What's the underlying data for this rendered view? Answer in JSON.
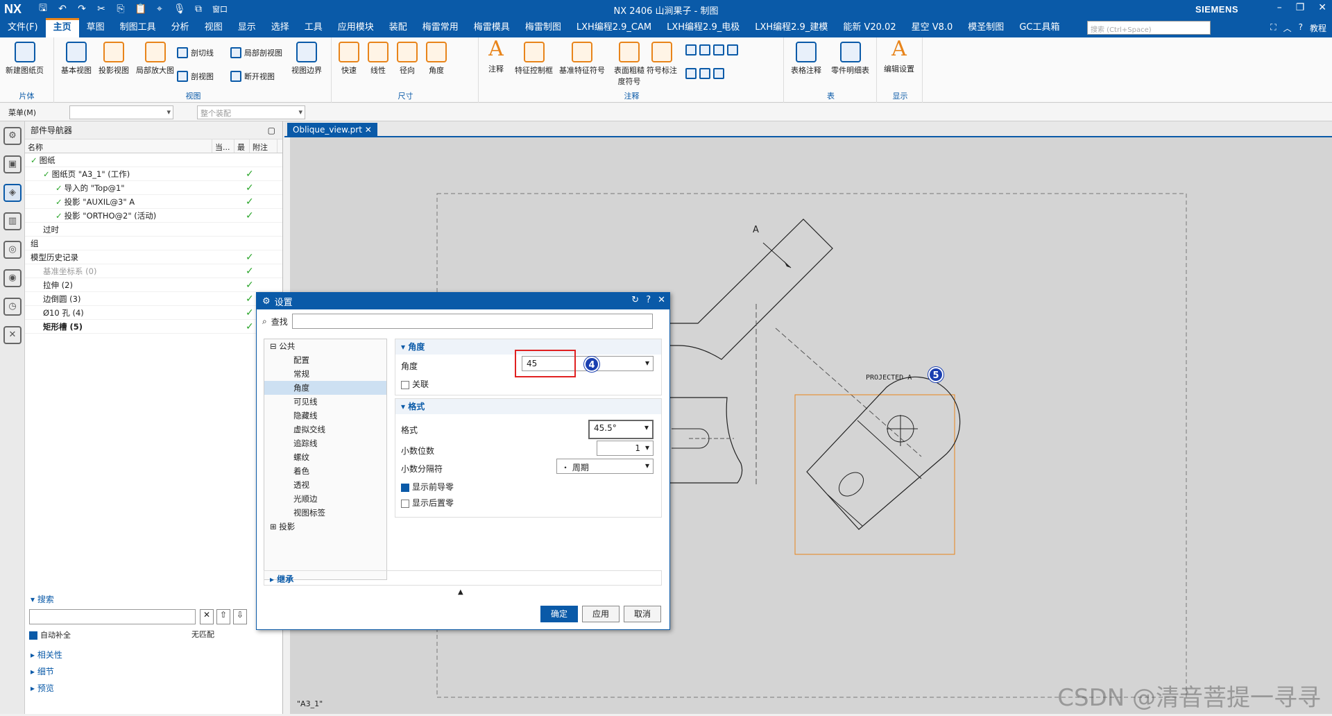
{
  "app": {
    "logo": "NX",
    "title": "NX 2406 山涧果子 - 制图",
    "brand": "SIEMENS",
    "window_menu": "窗口"
  },
  "menu": {
    "items": [
      "文件(F)",
      "主页",
      "草图",
      "制图工具",
      "分析",
      "视图",
      "显示",
      "选择",
      "工具",
      "应用模块",
      "装配",
      "梅雷常用",
      "梅雷模具",
      "梅雷制图",
      "LXH编程2.9_CAM",
      "LXH编程2.9_电极",
      "LXH编程2.9_建模",
      "能新 V20.02",
      "星空 V8.0",
      "模圣制图",
      "GC工具箱"
    ],
    "active_index": 1,
    "search_placeholder": "搜索 (Ctrl+Space)",
    "tutorial": "教程"
  },
  "ribbon": {
    "groups": {
      "sheet": "片体",
      "view": "视图",
      "dimension": "尺寸",
      "annotation": "注释",
      "table": "表",
      "display": "显示"
    },
    "buttons": {
      "new_sheet": "新建图纸页",
      "base_view": "基本视图",
      "proj_view": "投影视图",
      "detail_view": "局部放大图",
      "section_line": "剖切线",
      "partial_section": "局部剖视图",
      "section_view": "剖视图",
      "break_view": "断开视图",
      "view_boundary": "视图边界",
      "rapid": "快速",
      "linear": "线性",
      "radial": "径向",
      "angular": "角度",
      "note": "注释",
      "fcf": "特征控制框",
      "datum": "基准特征符号",
      "surface_finish": "表面粗糙度符号",
      "symbol_label": "符号标注",
      "table_note": "表格注释",
      "parts_list": "零件明细表",
      "edit_settings": "编辑设置"
    }
  },
  "toolbar2": {
    "menu_label": "菜单(M)",
    "assembly": "整个装配"
  },
  "navigator": {
    "title": "部件导航器",
    "columns": [
      "名称",
      "当...",
      "最",
      "附注"
    ],
    "rows": [
      {
        "label": "图纸",
        "level": 0,
        "check": true,
        "latest": false
      },
      {
        "label": "图纸页 \"A3_1\" (工作)",
        "level": 1,
        "check": true,
        "latest": true
      },
      {
        "label": "导入的 \"Top@1\"",
        "level": 2,
        "check": true,
        "latest": true
      },
      {
        "label": "投影 \"AUXIL@3\" A",
        "level": 2,
        "check": true,
        "latest": true
      },
      {
        "label": "投影 \"ORTHO@2\" (活动)",
        "level": 2,
        "check": true,
        "latest": true
      },
      {
        "label": "过时",
        "level": 1,
        "check": false,
        "latest": false
      },
      {
        "label": "组",
        "level": 0,
        "check": false,
        "latest": false
      },
      {
        "label": "模型历史记录",
        "level": 0,
        "check": false,
        "latest": true
      },
      {
        "label": "基准坐标系 (0)",
        "level": 1,
        "check": false,
        "latest": true,
        "muted": true
      },
      {
        "label": "拉伸 (2)",
        "level": 1,
        "check": false,
        "latest": true
      },
      {
        "label": "边倒圆 (3)",
        "level": 1,
        "check": false,
        "latest": true
      },
      {
        "label": "Ø10 孔 (4)",
        "level": 1,
        "check": false,
        "latest": true
      },
      {
        "label": "矩形槽 (5)",
        "level": 1,
        "check": false,
        "latest": true,
        "bold": true
      }
    ],
    "search_label": "搜索",
    "autocomplete": "自动补全",
    "no_match": "无匹配",
    "sections": [
      "相关性",
      "细节",
      "预览"
    ]
  },
  "document": {
    "tab": "Oblique_view.prt",
    "sheet": "\"A3_1\""
  },
  "drawing": {
    "label_a": "A",
    "projected_label": "PROJECTED  A",
    "badge4": "4",
    "badge5": "5"
  },
  "dialog": {
    "title": "设置",
    "find_label": "查找",
    "tree": {
      "common": "公共",
      "items": [
        "配置",
        "常规",
        "角度",
        "可见线",
        "隐藏线",
        "虚拟交线",
        "追踪线",
        "螺纹",
        "着色",
        "透视",
        "光顺边",
        "视图标签"
      ],
      "selected": 2,
      "projection": "投影"
    },
    "angle_section": "角度",
    "angle_label": "角度",
    "angle_value": "45",
    "associative": "关联",
    "format_section": "格式",
    "format_label": "格式",
    "format_value": "45.5°",
    "decimals_label": "小数位数",
    "decimals_value": "1",
    "separator_label": "小数分隔符",
    "separator_value": "・ 周期",
    "show_leading": "显示前导零",
    "show_trailing": "显示后置零",
    "inherit": "继承",
    "ok": "确定",
    "apply": "应用",
    "cancel": "取消"
  },
  "watermark": "CSDN @清音菩提一寻寻"
}
